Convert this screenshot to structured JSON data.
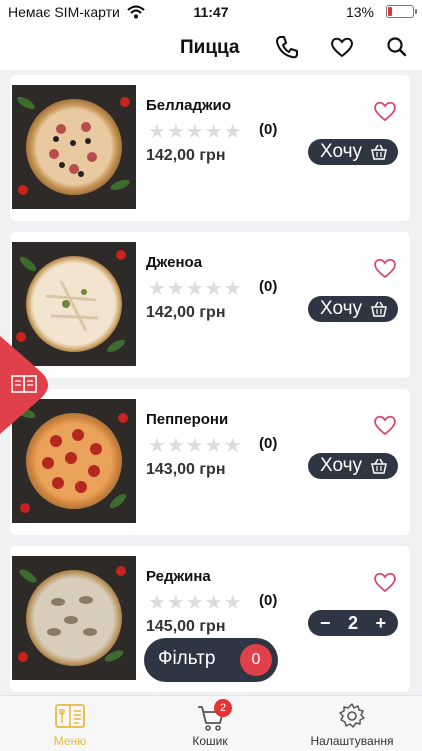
{
  "status_bar": {
    "carrier": "Немає SIM-карти",
    "time": "11:47",
    "battery": "13%"
  },
  "header": {
    "title": "Пицца"
  },
  "products": [
    {
      "name": "Белладжио",
      "rating_count": "(0)",
      "price": "142,00 грн",
      "action": "want",
      "want_label": "Хочу"
    },
    {
      "name": "Дженоа",
      "rating_count": "(0)",
      "price": "142,00 грн",
      "action": "want",
      "want_label": "Хочу"
    },
    {
      "name": "Пепперони",
      "rating_count": "(0)",
      "price": "143,00 грн",
      "action": "want",
      "want_label": "Хочу"
    },
    {
      "name": "Реджина",
      "rating_count": "(0)",
      "price": "145,00 грн",
      "action": "stepper",
      "quantity": "2"
    }
  ],
  "stepper": {
    "minus": "−",
    "plus": "+"
  },
  "filter": {
    "label": "Фільтр",
    "count": "0"
  },
  "tabbar": {
    "items": [
      {
        "label": "Меню",
        "icon": "menu-book-icon",
        "active": true
      },
      {
        "label": "Кошик",
        "icon": "cart-icon",
        "badge": "2"
      },
      {
        "label": "Налаштування",
        "icon": "gear-icon"
      }
    ]
  },
  "colors": {
    "accent": "#e04049",
    "dark_button": "#2e3644",
    "active_tab": "#e8b93f",
    "fav_pink": "#d94a6a"
  }
}
